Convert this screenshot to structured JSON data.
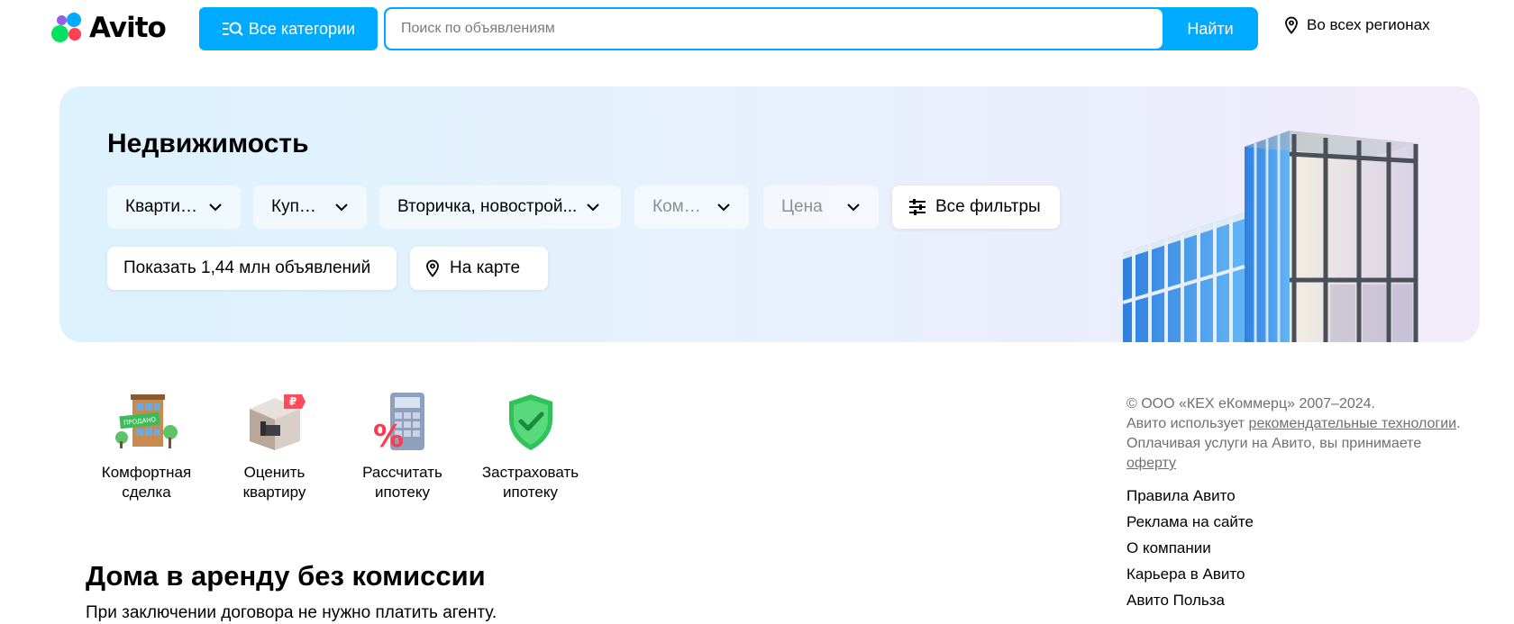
{
  "header": {
    "logo_text": "Avito",
    "categories_label": "Все категории",
    "search": {
      "placeholder": "Поиск по объявлениям",
      "value": ""
    },
    "search_button": "Найти",
    "region": "Во всех регионах",
    "accent_color": "#00aaff"
  },
  "hero": {
    "title": "Недвижимость",
    "filters": [
      {
        "label": "Квартира"
      },
      {
        "label": "Купить"
      },
      {
        "label": "Вторичка, новострой..."
      },
      {
        "label": "Комна..."
      },
      {
        "label": "Цена"
      }
    ],
    "all_filters": "Все фильтры",
    "show_button": "Показать 1,44 млн объявлений",
    "map_button": "На карте"
  },
  "services": [
    {
      "line1": "Комфортная",
      "line2": "сделка",
      "icon": "sold-house-icon"
    },
    {
      "line1": "Оценить квартиру",
      "line2": "",
      "icon": "apartment-valuation-icon"
    },
    {
      "line1": "Рассчитать",
      "line2": "ипотеку",
      "icon": "calculator-icon"
    },
    {
      "line1": "Застраховать",
      "line2": "ипотеку",
      "icon": "shield-check-icon"
    }
  ],
  "promo": {
    "title": "Дома в аренду без комиссии",
    "subtitle": "При заключении договора не нужно платить агенту."
  },
  "footer": {
    "copyright": "© ООО «КЕХ еКоммерц» 2007–2024.",
    "uses_text": "Авито использует ",
    "rec_link": "рекомендательные технологии",
    "pay_text": ". Оплачивая услуги на Авито, вы принимаете ",
    "offer_link": "оферту",
    "links": [
      "Правила Авито",
      "Реклама на сайте",
      "О компании",
      "Карьера в Авито",
      "Авито Польза"
    ]
  }
}
